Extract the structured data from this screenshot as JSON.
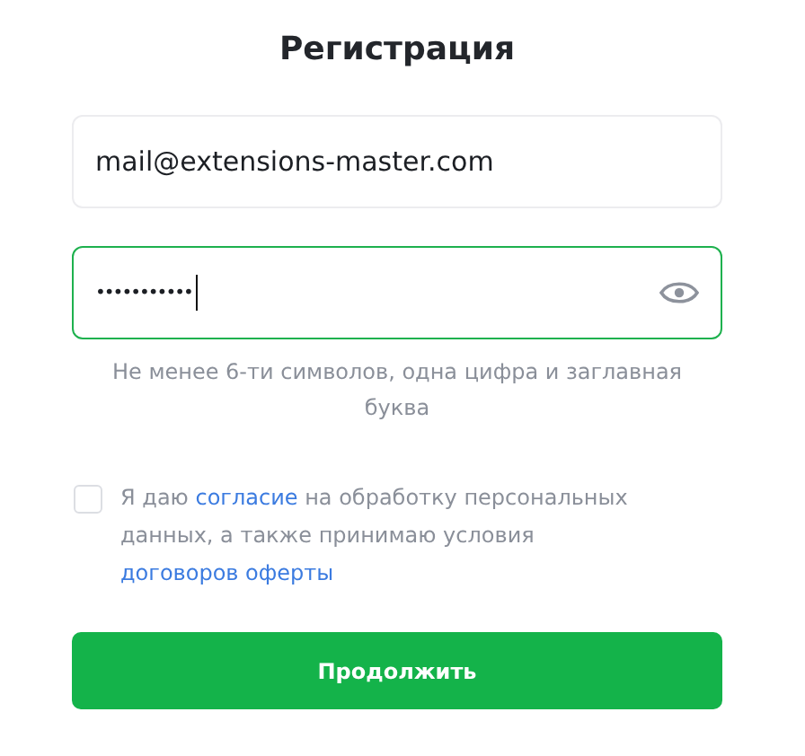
{
  "title": "Регистрация",
  "email": {
    "value": "mail@extensions-master.com"
  },
  "password": {
    "value": "•••••••••••",
    "focused": true
  },
  "password_hint": "Не менее 6-ти символов, одна цифра и заглавная буква",
  "consent": {
    "checked": false,
    "parts": [
      {
        "kind": "plain",
        "text": "Я даю "
      },
      {
        "kind": "link",
        "text": "согласие"
      },
      {
        "kind": "plain",
        "text": " на обработку персональных данных, а также принимаю условия "
      },
      {
        "kind": "link",
        "text": "договоров оферты"
      }
    ]
  },
  "submit_button": "Продолжить"
}
